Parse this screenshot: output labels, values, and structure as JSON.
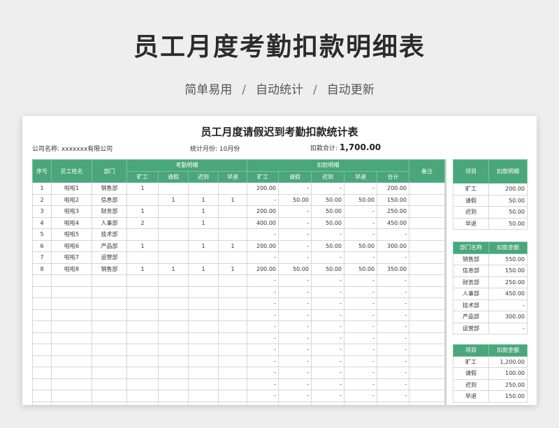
{
  "hero": {
    "title": "员工月度考勤扣款明细表",
    "subtitle_parts": [
      "简单易用",
      "自动统计",
      "自动更新"
    ],
    "separator": "/"
  },
  "sheet": {
    "title": "员工月度请假迟到考勤扣款统计表",
    "company_label": "公司名称:",
    "company_value": "xxxxxxx有限公司",
    "month_label": "统计月份:",
    "month_value": "10月份",
    "total_label": "扣款合计:",
    "total_value": "1,700.00"
  },
  "main_table": {
    "headers": {
      "no": "序号",
      "name": "员工姓名",
      "dept": "部门",
      "attendance_group": "考勤明细",
      "deduction_group": "扣款明细",
      "remark": "备注",
      "attendance_cols": [
        "旷工",
        "请假",
        "迟到",
        "早退"
      ],
      "deduction_cols": [
        "旷工",
        "请假",
        "迟到",
        "早退",
        "合计"
      ]
    },
    "rows": [
      [
        "1",
        "啦啦1",
        "销售部",
        "1",
        "",
        "",
        "",
        "200.00",
        "-",
        "-",
        "-",
        "200.00",
        ""
      ],
      [
        "2",
        "啦啦2",
        "信息部",
        "",
        "1",
        "1",
        "1",
        "-",
        "50.00",
        "50.00",
        "50.00",
        "150.00",
        ""
      ],
      [
        "3",
        "啦啦3",
        "财务部",
        "1",
        "",
        "1",
        "",
        "200.00",
        "-",
        "50.00",
        "-",
        "250.00",
        ""
      ],
      [
        "4",
        "啦啦4",
        "人事部",
        "2",
        "",
        "1",
        "",
        "400.00",
        "-",
        "50.00",
        "-",
        "450.00",
        ""
      ],
      [
        "5",
        "啦啦5",
        "技术部",
        "",
        "",
        "",
        "",
        "-",
        "-",
        "-",
        "-",
        "-",
        ""
      ],
      [
        "6",
        "啦啦6",
        "产品部",
        "1",
        "",
        "1",
        "1",
        "200.00",
        "-",
        "50.00",
        "50.00",
        "300.00",
        ""
      ],
      [
        "7",
        "啦啦7",
        "运营部",
        "",
        "",
        "",
        "",
        "-",
        "-",
        "-",
        "-",
        "-",
        ""
      ],
      [
        "8",
        "啦啦8",
        "销售部",
        "1",
        "1",
        "1",
        "1",
        "200.00",
        "50.00",
        "50.00",
        "50.00",
        "350.00",
        ""
      ],
      [
        "",
        "",
        "",
        "",
        "",
        "",
        "",
        "-",
        "-",
        "-",
        "-",
        "-",
        ""
      ],
      [
        "",
        "",
        "",
        "",
        "",
        "",
        "",
        "-",
        "-",
        "-",
        "-",
        "-",
        ""
      ],
      [
        "",
        "",
        "",
        "",
        "",
        "",
        "",
        "-",
        "-",
        "-",
        "-",
        "-",
        ""
      ],
      [
        "",
        "",
        "",
        "",
        "",
        "",
        "",
        "-",
        "-",
        "-",
        "-",
        "-",
        ""
      ],
      [
        "",
        "",
        "",
        "",
        "",
        "",
        "",
        "-",
        "-",
        "-",
        "-",
        "-",
        ""
      ],
      [
        "",
        "",
        "",
        "",
        "",
        "",
        "",
        "-",
        "-",
        "-",
        "-",
        "-",
        ""
      ],
      [
        "",
        "",
        "",
        "",
        "",
        "",
        "",
        "-",
        "-",
        "-",
        "-",
        "-",
        ""
      ],
      [
        "",
        "",
        "",
        "",
        "",
        "",
        "",
        "-",
        "-",
        "-",
        "-",
        "-",
        ""
      ],
      [
        "",
        "",
        "",
        "",
        "",
        "",
        "",
        "-",
        "-",
        "-",
        "-",
        "-",
        ""
      ],
      [
        "",
        "",
        "",
        "",
        "",
        "",
        "",
        "-",
        "-",
        "-",
        "-",
        "-",
        ""
      ],
      [
        "",
        "",
        "",
        "",
        "",
        "",
        "",
        "-",
        "-",
        "-",
        "-",
        "-",
        ""
      ],
      [
        "",
        "",
        "",
        "",
        "",
        "",
        "",
        "-",
        "-",
        "-",
        "-",
        "-",
        ""
      ]
    ]
  },
  "side_tables": [
    {
      "headers": [
        "项目",
        "扣款明细"
      ],
      "rows": [
        [
          "旷工",
          "200.00"
        ],
        [
          "请假",
          "50.00"
        ],
        [
          "迟到",
          "50.00"
        ],
        [
          "早退",
          "50.00"
        ]
      ]
    },
    {
      "headers": [
        "部门名称",
        "扣款金额"
      ],
      "rows": [
        [
          "销售部",
          "550.00"
        ],
        [
          "信息部",
          "150.00"
        ],
        [
          "财务部",
          "250.00"
        ],
        [
          "人事部",
          "450.00"
        ],
        [
          "技术部",
          "-"
        ],
        [
          "产品部",
          "300.00"
        ],
        [
          "运营部",
          "-"
        ]
      ]
    },
    {
      "headers": [
        "项目",
        "扣款金额"
      ],
      "rows": [
        [
          "旷工",
          "1,200.00"
        ],
        [
          "请假",
          "100.00"
        ],
        [
          "迟到",
          "250.00"
        ],
        [
          "早退",
          "150.00"
        ]
      ]
    }
  ]
}
